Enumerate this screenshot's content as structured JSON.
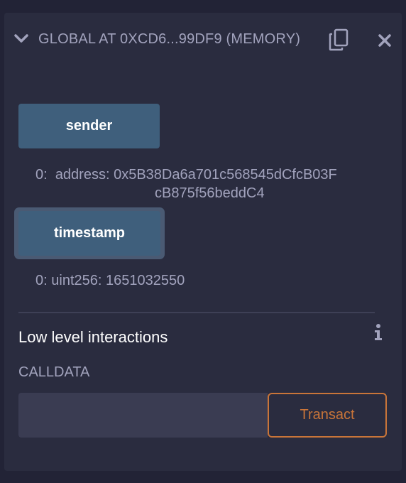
{
  "header": {
    "title": "GLOBAL AT 0XCD6...99DF9 (MEMORY)",
    "icons": {
      "collapse": "chevron-down-icon",
      "copy": "copy-icon",
      "close": "close-icon"
    }
  },
  "functions": [
    {
      "label": "sender",
      "result": {
        "prefix": "0:",
        "type": "address:",
        "value_line1": "0x5B38Da6a701c568545dCfcB03F",
        "value_line2": "cB875f56beddC4"
      }
    },
    {
      "label": "timestamp",
      "result": {
        "prefix": "0:",
        "type": "uint256:",
        "value": "1651032550"
      }
    }
  ],
  "low_level": {
    "title": "Low level interactions",
    "info_icon": "info-icon",
    "calldata_label": "CALLDATA",
    "calldata_value": "",
    "transact_label": "Transact"
  },
  "colors": {
    "background": "#222336",
    "panel": "#2a2c3f",
    "function_button": "#3f5f7c",
    "transact_accent": "#c97539",
    "muted_text": "#a2a3bd"
  }
}
